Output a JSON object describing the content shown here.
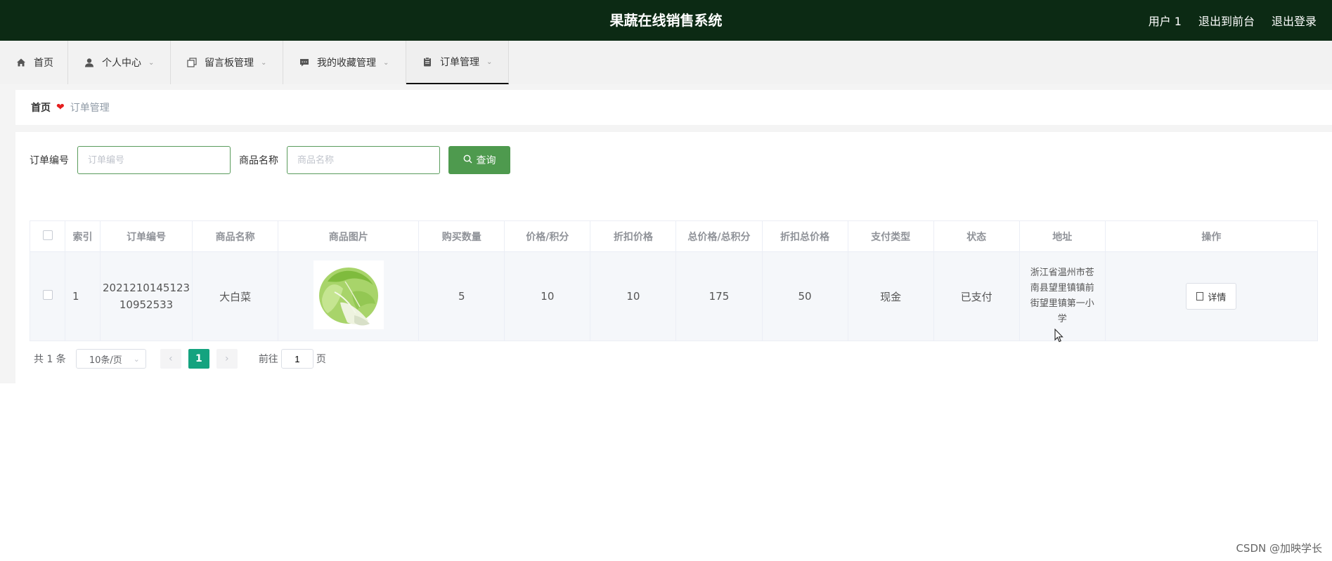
{
  "header": {
    "title": "果蔬在线销售系统",
    "user": "用户 1",
    "to_front": "退出到前台",
    "logout": "退出登录",
    "bg_color": "#0c2a14"
  },
  "nav": {
    "items": [
      {
        "label": "首页",
        "icon": "home-icon"
      },
      {
        "label": "个人中心",
        "icon": "user-icon"
      },
      {
        "label": "留言板管理",
        "icon": "copy-icon"
      },
      {
        "label": "我的收藏管理",
        "icon": "chat-icon"
      },
      {
        "label": "订单管理",
        "icon": "clipboard-icon"
      }
    ],
    "active_index": 4
  },
  "breadcrumb": {
    "home": "首页",
    "current": "订单管理"
  },
  "search": {
    "order_no_label": "订单编号",
    "order_no_placeholder": "订单编号",
    "product_name_label": "商品名称",
    "product_name_placeholder": "商品名称",
    "query_button": "查询",
    "accent": "#4e9a4e"
  },
  "table": {
    "headers": [
      "索引",
      "订单编号",
      "商品名称",
      "商品图片",
      "购买数量",
      "价格/积分",
      "折扣价格",
      "总价格/总积分",
      "折扣总价格",
      "支付类型",
      "状态",
      "地址",
      "操作"
    ],
    "rows": [
      {
        "index": "1",
        "order_no_line1": "2021210145123",
        "order_no_line2": "10952533",
        "product_name": "大白菜",
        "image": "napa-cabbage-image",
        "quantity": "5",
        "price": "10",
        "discount_price": "10",
        "total": "175",
        "discount_total": "50",
        "pay_type": "现金",
        "status": "已支付",
        "address_line1": "浙江省温州市苍",
        "address_line2": "南县望里镇镇前",
        "address_line3": "街望里镇第一小",
        "address_line4": "学",
        "action": "详情"
      }
    ]
  },
  "pagination": {
    "total": "共 1 条",
    "page_size": "10条/页",
    "current_page": "1",
    "goto_label": "前往",
    "goto_value": "1",
    "page_unit": "页",
    "active_color": "#14a37f"
  },
  "watermark": "CSDN @加映学长"
}
